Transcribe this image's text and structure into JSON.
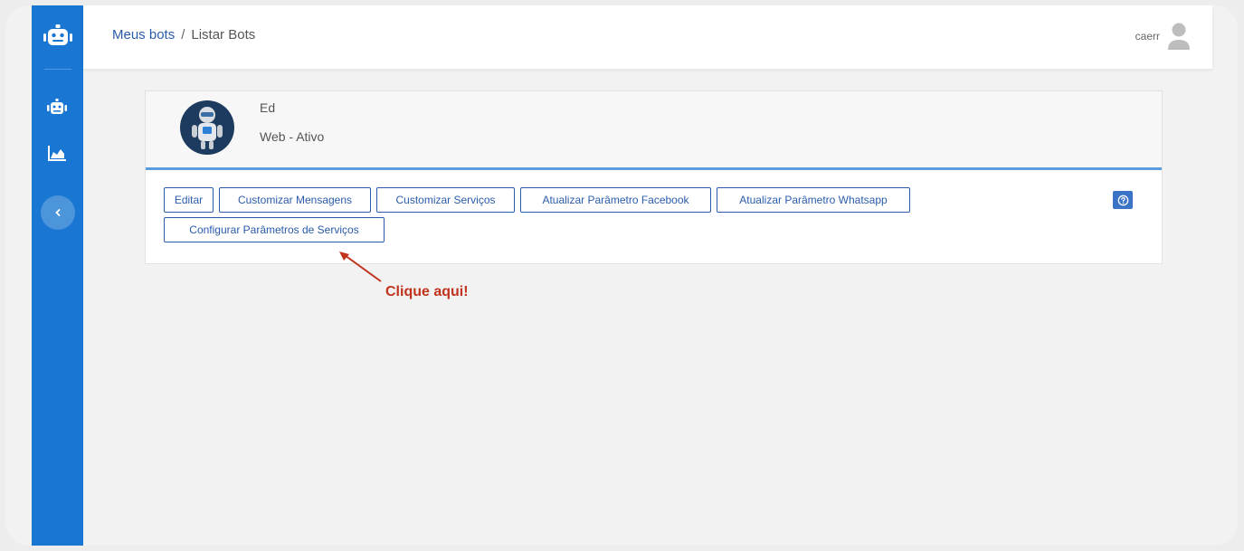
{
  "breadcrumb": {
    "root": "Meus bots",
    "separator": "/",
    "current": "Listar Bots"
  },
  "user": {
    "name": "caerr",
    "avatar_icon": "user-avatar-icon"
  },
  "sidebar": {
    "logo_icon": "robot-logo-icon",
    "items": [
      {
        "icon": "robot-icon",
        "label": ""
      },
      {
        "icon": "area-chart-icon",
        "label": ""
      }
    ],
    "collapse_icon": "chevron-left-icon"
  },
  "bot": {
    "name": "Ed",
    "status": "Web - Ativo",
    "avatar_icon": "bot-avatar-icon"
  },
  "actions": {
    "edit": "Editar",
    "custom_messages": "Customizar Mensagens",
    "custom_services": "Customizar Serviços",
    "update_facebook": "Atualizar Parâmetro Facebook",
    "update_whatsapp": "Atualizar Parâmetro Whatsapp",
    "configure_services": "Configurar Parâmetros de Serviços",
    "help_icon": "help-circle-icon"
  },
  "annotation": {
    "text": "Clique aqui!"
  },
  "colors": {
    "sidebar": "#1976d2",
    "accent": "#2a5caa",
    "annotation": "#c0331d"
  }
}
